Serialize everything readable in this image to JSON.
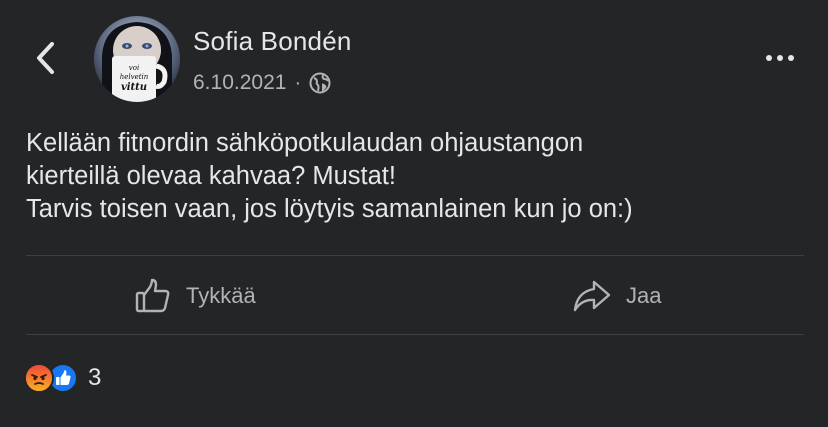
{
  "post": {
    "author": "Sofia Bondén",
    "date": "6.10.2021",
    "separator": "·",
    "avatar_icon": "avatar-photo-mug",
    "avatar_mug_lines": [
      "voi",
      "helvetin",
      "vittu"
    ],
    "privacy_icon": "globe-icon",
    "text_lines": [
      "Kellään fitnordin sähköpotkulaudan ohjaustangon",
      "kierteillä olevaa kahvaa? Mustat!",
      "Tarvis toisen vaan, jos löytyis samanlainen kun jo on:)"
    ]
  },
  "nav": {
    "back_icon": "chevron-left-icon",
    "more_icon": "more-horizontal-icon"
  },
  "actions": {
    "like_label": "Tykkää",
    "like_icon": "thumbs-up-outline-icon",
    "share_label": "Jaa",
    "share_icon": "share-arrow-icon"
  },
  "reactions": {
    "types": [
      "angry",
      "like"
    ],
    "count": "3"
  },
  "colors": {
    "background": "#242526",
    "text_primary": "#e4e6eb",
    "text_secondary": "#b0b3b8",
    "divider": "#3e4042",
    "like_blue": "#1877f2",
    "angry_orange": "#e9710f"
  }
}
